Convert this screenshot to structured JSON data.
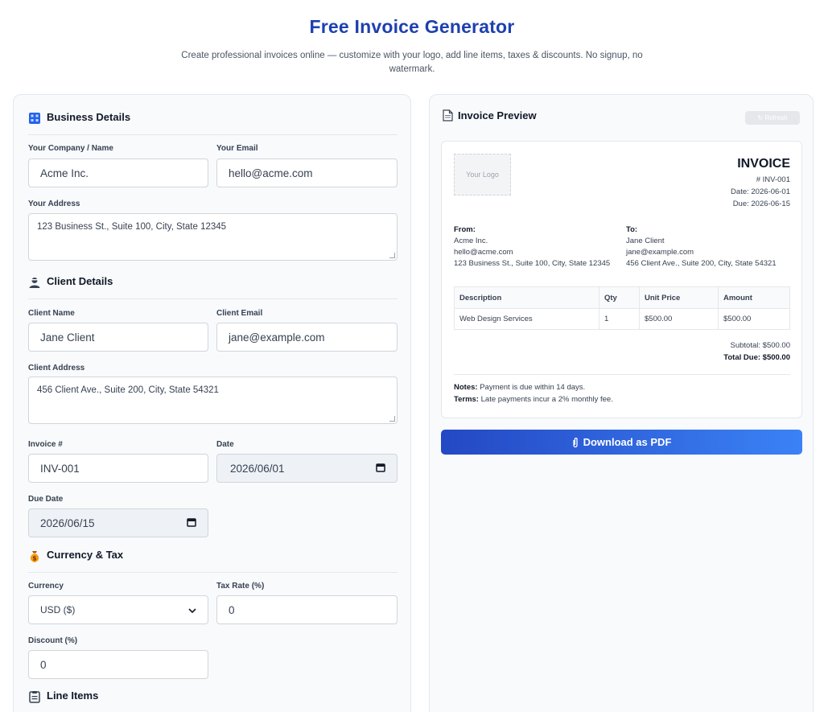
{
  "header": {
    "title": "Free Invoice Generator",
    "subtitle": "Create professional invoices online — customize with your logo, add line items, taxes & discounts. No signup, no watermark."
  },
  "form": {
    "business_section": "Business Details",
    "company_label": "Your Company / Name",
    "company_value": "Acme Inc.",
    "email_label": "Your Email",
    "email_value": "hello@acme.com",
    "address_label": "Your Address",
    "address_value": "123 Business St., Suite 100, City, State 12345",
    "client_section": "Client Details",
    "client_name_label": "Client Name",
    "client_name_value": "Jane Client",
    "client_email_label": "Client Email",
    "client_email_value": "jane@example.com",
    "client_address_label": "Client Address",
    "client_address_value": "456 Client Ave., Suite 200, City, State 54321",
    "invoice_no_label": "Invoice #",
    "invoice_no_value": "INV-001",
    "date_label": "Date",
    "date_value": "2026/06/01",
    "due_label": "Due Date",
    "due_value": "2026/06/15",
    "currency_section": "Currency & Tax",
    "currency_label": "Currency",
    "currency_value": "USD ($)",
    "tax_label": "Tax Rate (%)",
    "tax_value": "0",
    "discount_label": "Discount (%)",
    "discount_value": "0",
    "line_items_section": "Line Items"
  },
  "preview": {
    "title": "Invoice Preview",
    "refresh_label": "↻ Refresh",
    "logo_placeholder": "Your Logo",
    "invoice_heading": "INVOICE",
    "invoice_number": "# INV-001",
    "date": "Date: 2026-06-01",
    "due": "Due: 2026-06-15",
    "from_label": "From:",
    "from_name": "Acme Inc.",
    "from_email": "hello@acme.com",
    "from_address": "123 Business St., Suite 100, City, State 12345",
    "to_label": "To:",
    "to_name": "Jane Client",
    "to_email": "jane@example.com",
    "to_address": "456 Client Ave., Suite 200, City, State 54321",
    "table_headers": [
      "Description",
      "Qty",
      "Unit Price",
      "Amount"
    ],
    "rows": [
      {
        "description": "Web Design Services",
        "qty": "1",
        "unit_price": "$500.00",
        "amount": "$500.00"
      }
    ],
    "subtotal": "Subtotal: $500.00",
    "total_due": "Total Due: $500.00",
    "notes_label": "Notes:",
    "notes_text": " Payment is due within 14 days.",
    "terms_label": "Terms:",
    "terms_text": " Late payments incur a 2% monthly fee."
  },
  "download_label": "Download as PDF",
  "colors": {
    "title": "#1e40af",
    "button_start": "#2448c4",
    "button_end": "#3b82f6",
    "panel_bg": "#f8fafc"
  }
}
